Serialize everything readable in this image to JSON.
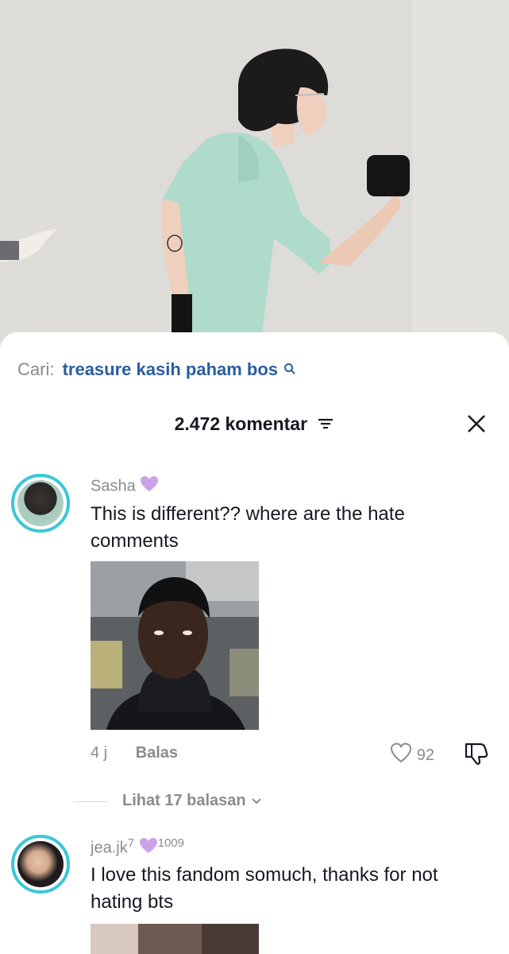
{
  "search": {
    "prefix": "Cari:",
    "query": "treasure kasih paham bos"
  },
  "comments_header": {
    "count_label": "2.472 komentar"
  },
  "comments": [
    {
      "username": "Sasha",
      "text": "This is different?? where are the hate comments",
      "time": "4 j",
      "reply_label": "Balas",
      "likes": "92",
      "view_replies": "Lihat 17 balasan"
    },
    {
      "username": "jea.jk",
      "name_superscript": "7",
      "badge_count": "1009",
      "text": "I love this fandom somuch, thanks for not hating bts"
    }
  ],
  "colors": {
    "accent_link": "#2a5d9f",
    "avatar_ring": "#3ac8d8",
    "badge_purple": "#c9a2ea",
    "muted_text": "#8a8b91"
  },
  "icons": [
    "search-icon",
    "filter-icon",
    "close-icon",
    "heart-icon",
    "dislike-icon",
    "chevron-down-icon",
    "purple-heart-icon"
  ]
}
